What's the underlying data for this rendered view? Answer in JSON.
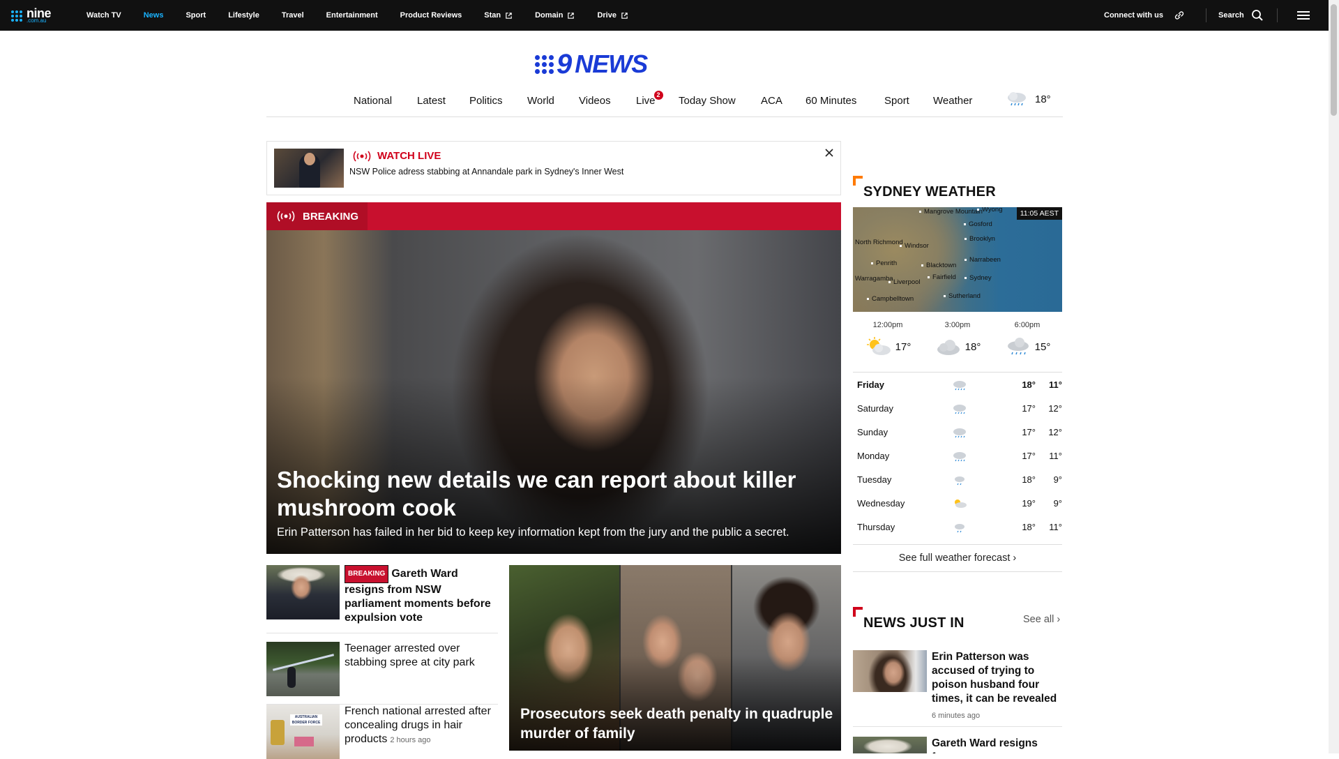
{
  "site": {
    "logo_top": "nine",
    "logo_bottom": ".com.au",
    "nav": [
      {
        "label": "Watch TV",
        "active": false,
        "external": false
      },
      {
        "label": "News",
        "active": true,
        "external": false
      },
      {
        "label": "Sport",
        "active": false,
        "external": false
      },
      {
        "label": "Lifestyle",
        "active": false,
        "external": false
      },
      {
        "label": "Travel",
        "active": false,
        "external": false
      },
      {
        "label": "Entertainment",
        "active": false,
        "external": false
      },
      {
        "label": "Product Reviews",
        "active": false,
        "external": false
      },
      {
        "label": "Stan",
        "active": false,
        "external": true
      },
      {
        "label": "Domain",
        "active": false,
        "external": true
      },
      {
        "label": "Drive",
        "active": false,
        "external": true
      }
    ],
    "connect_label": "Connect with us",
    "search_label": "Search"
  },
  "brand": {
    "nine": "9",
    "news": "NEWS"
  },
  "sections": {
    "items": [
      "National",
      "Latest",
      "Politics",
      "World",
      "Videos",
      "Live",
      "Today Show",
      "ACA",
      "60 Minutes",
      "Sport",
      "Weather"
    ],
    "live_count": "2",
    "temp": "18°"
  },
  "watch_live": {
    "label": "WATCH LIVE",
    "text": "NSW Police adress stabbing at Annandale park in Sydney's Inner West"
  },
  "hero": {
    "tag": "BREAKING",
    "title": "Shocking new details we can report about killer mushroom cook",
    "subtitle": "Erin Patterson has failed in her bid to keep key information kept from the jury and the public a secret."
  },
  "stories": [
    {
      "tag": "BREAKING",
      "title": "Gareth Ward resigns from NSW parliament moments before expulsion vote",
      "ago": ""
    },
    {
      "tag": "",
      "title": "Teenager arrested over stabbing spree at city park",
      "ago": ""
    },
    {
      "tag": "",
      "title": "French national arrested after concealing drugs in hair products",
      "ago": "2 hours ago"
    }
  ],
  "feature": {
    "title": "Prosecutors seek death penalty in quadruple murder of family"
  },
  "weather": {
    "heading": "SYDNEY WEATHER",
    "map_time": "11:05 AEST",
    "places": [
      "Mangrove Mountain",
      "Wyong",
      "Gosford",
      "North Richmond",
      "Windsor",
      "Brooklyn",
      "Penrith",
      "Blacktown",
      "Narrabeen",
      "Warragamba",
      "Liverpool",
      "Fairfield",
      "Sydney",
      "Sutherland",
      "Campbelltown"
    ],
    "hourly": [
      {
        "time": "12:00pm",
        "temp": "17°",
        "icon": "sun-cloud-icon"
      },
      {
        "time": "3:00pm",
        "temp": "18°",
        "icon": "cloud-icon"
      },
      {
        "time": "6:00pm",
        "temp": "15°",
        "icon": "rain-cloud-icon"
      }
    ],
    "daily": [
      {
        "day": "Friday",
        "hi": "18°",
        "lo": "11°",
        "icon": "rain-cloud-icon"
      },
      {
        "day": "Saturday",
        "hi": "17°",
        "lo": "12°",
        "icon": "rain-cloud-icon"
      },
      {
        "day": "Sunday",
        "hi": "17°",
        "lo": "12°",
        "icon": "rain-cloud-icon"
      },
      {
        "day": "Monday",
        "hi": "17°",
        "lo": "11°",
        "icon": "rain-cloud-icon"
      },
      {
        "day": "Tuesday",
        "hi": "18°",
        "lo": "9°",
        "icon": "shower-icon"
      },
      {
        "day": "Wednesday",
        "hi": "19°",
        "lo": "9°",
        "icon": "sun-cloud-icon"
      },
      {
        "day": "Thursday",
        "hi": "18°",
        "lo": "11°",
        "icon": "shower-icon"
      }
    ],
    "full_forecast": "See full weather forecast"
  },
  "news_just_in": {
    "heading": "NEWS JUST IN",
    "see_all": "See all ›",
    "items": [
      {
        "title": "Erin Patterson was accused of trying to poison husband four times, it can be revealed",
        "ago": "6 minutes ago"
      },
      {
        "title": "Gareth Ward resigns from",
        "ago": ""
      }
    ]
  },
  "colors": {
    "accent": "#1ab3ff",
    "brand": "#1a3bd6",
    "breaking": "#c8102e",
    "weather_corner": "#ff7a00"
  }
}
